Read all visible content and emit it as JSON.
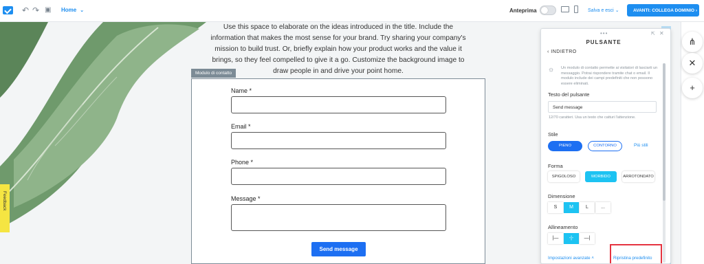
{
  "topbar": {
    "undo_icon": "undo-icon",
    "redo_icon": "redo-icon",
    "save_icon": "save-icon",
    "page_select": "Home",
    "preview_label": "Anteprima",
    "preview_on": false,
    "save_exit": "Salva e esci",
    "next_button": "AVANTI: COLLEGA DOMINIO",
    "brand_color": "#1d8ef0"
  },
  "canvas": {
    "intro_text": "Use this space to elaborate on the ideas introduced in the title. Include the information that makes the most sense for your brand. Try sharing your company's mission to build trust. Or, briefly explain how your product works and the value it brings, so they feel compelled to give it a go. Customize the background image to draw people in and drive your point home.",
    "form_tag": "Modulo di contatto",
    "fields": [
      {
        "label": "Name *"
      },
      {
        "label": "Email *"
      },
      {
        "label": "Phone *"
      },
      {
        "label": "Message *"
      }
    ],
    "send_button": "Send message",
    "feedback": "Feedback"
  },
  "panel": {
    "title": "PULSANTE",
    "back": "INDIETRO",
    "hint": "Un modulo di contatto permette ai visitatori di lasciarti un messaggio. Potrai rispondere tramite chat o email. Il modulo include dei campi predefiniti che non possono essere eliminati.",
    "button_text_label": "Testo del pulsante",
    "button_text_value": "Send message",
    "char_hint": "12/70 caratteri. Usa un testo che catturi l'attenzione.",
    "style_label": "Stile",
    "style_solid": "PIENO",
    "style_outline": "CONTORNO",
    "more_styles": "Più stili",
    "shape_label": "Forma",
    "shape_options": [
      "SPIGOLOSO",
      "MORBIDO",
      "ARROTONDATO"
    ],
    "shape_selected": "MORBIDO",
    "size_label": "Dimensione",
    "size_options": [
      "S",
      "M",
      "L",
      "..."
    ],
    "size_selected": "M",
    "align_label": "Allineamento",
    "align_options": [
      "|—",
      "-|-",
      "—|"
    ],
    "align_selected": "-|-",
    "advanced": "Impostazioni avanzate",
    "reset": "Ripristina predefinito"
  },
  "right_bar": {
    "icons": [
      "sitemap-icon",
      "close-icon",
      "add-icon"
    ]
  }
}
